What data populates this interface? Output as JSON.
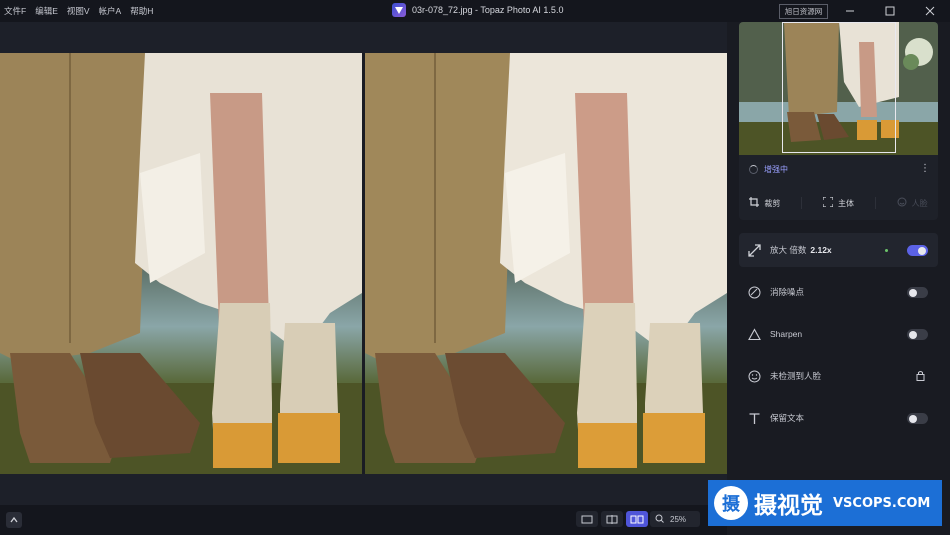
{
  "menu": [
    "文件F",
    "编辑E",
    "视图V",
    "帐户A",
    "帮助H"
  ],
  "window": {
    "title": "03r-078_72.jpg - Topaz Photo AI 1.5.0",
    "resource_label": "旭日资源网",
    "minimize_icon": "minimize-icon",
    "maximize_icon": "maximize-icon",
    "close_icon": "close-icon"
  },
  "sidebar": {
    "status": "增强中",
    "tools": {
      "crop": "裁剪",
      "subject": "主体",
      "face": "人脸"
    },
    "features": [
      {
        "label": "放大 倍数",
        "value": "2.12x",
        "toggle": true,
        "icon": "upscale-icon"
      },
      {
        "label": "消除噪点",
        "toggle": false,
        "icon": "denoise-icon"
      },
      {
        "label": "Sharpen",
        "toggle": false,
        "icon": "sharpen-icon"
      },
      {
        "label": "未检测到人脸",
        "locked": true,
        "icon": "face-icon"
      },
      {
        "label": "保留文本",
        "toggle": false,
        "icon": "text-icon"
      }
    ]
  },
  "bottombar": {
    "zoom": "25%",
    "view_modes": [
      "single-view",
      "split-view",
      "side-by-side-view"
    ],
    "active_view": "side-by-side-view"
  },
  "watermark": {
    "mark": "摄",
    "text": "摄视觉",
    "sub": "VSCOPS.COM"
  },
  "colors": {
    "accent": "#5b62e6",
    "panel": "#191b22",
    "watermark": "#1c6fd6"
  }
}
